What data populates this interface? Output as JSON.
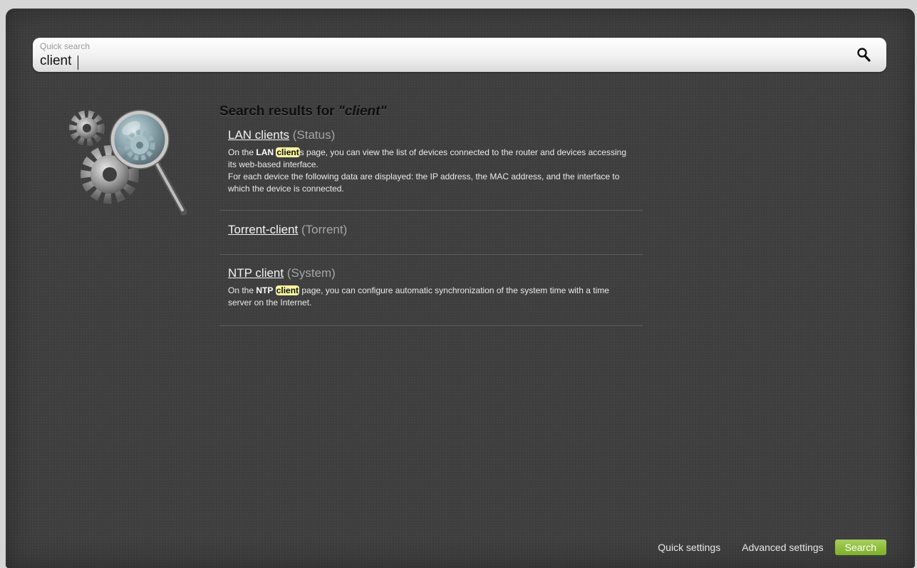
{
  "search": {
    "caption": "Quick search",
    "value": "client"
  },
  "results": {
    "title_prefix": "Search results for",
    "title_query": "\"client\"",
    "items": [
      {
        "link": "LAN clients",
        "category": "(Status)",
        "desc_pre": "On the ",
        "desc_bold": "LAN",
        "desc_hl": "client",
        "desc_post": "s page, you can view the list of devices connected to the router and devices accessing its web-based interface.",
        "desc_line2": "For each device the following data are displayed: the IP address, the MAC address, and the interface to which the device is connected."
      },
      {
        "link": "Torrent-client",
        "category": "(Torrent)"
      },
      {
        "link": "NTP client",
        "category": "(System)",
        "desc_pre": "On the ",
        "desc_bold": "NTP",
        "desc_hl": "client",
        "desc_post": " page, you can configure automatic synchronization of the system time with a time server on the Internet."
      }
    ]
  },
  "footer": {
    "quick_settings": "Quick settings",
    "advanced_settings": "Advanced settings",
    "search": "Search"
  },
  "colors": {
    "background": "#3e3e3e",
    "highlight": "#f7f3a1",
    "accent_green": "#8dbf3a"
  },
  "icons": {
    "search": "magnifier-icon",
    "illustration": "gears-magnifier-icon"
  }
}
